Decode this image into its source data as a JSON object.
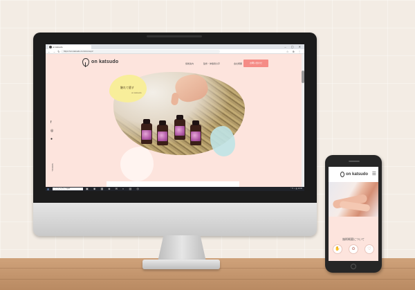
{
  "browser": {
    "tab_title": "on katsudo",
    "window_controls": "– ▢ ✕",
    "nav_icons": "← → ↻ ⌂",
    "url": "https://on-katsudo.com/concept/",
    "extension_icons": "☆ ⊕ ⋮"
  },
  "site": {
    "logo": "on katsudo",
    "nav": [
      "施術案内",
      "監修・体験者の声",
      "会社概要"
    ],
    "contact_button": "お問い合わせ",
    "hero_heading": "触れて癒す",
    "hero_sub": "on katsudo",
    "vertical_text": "SCROLL",
    "social_icons": [
      "facebook-icon",
      "instagram-icon",
      "line-icon"
    ]
  },
  "taskbar": {
    "start": "⊞",
    "search_placeholder": "ここに入力して検索",
    "app_icons": "▣ ◉ ▦ ◈ ✉ ◐ ▤ ◎",
    "tray_text": "^ ☐ ♫ あ 12:00"
  },
  "phone": {
    "logo": "on katsudo",
    "menu_icon": "☰",
    "heading": "施術概要について",
    "feature_icons": [
      "✋",
      "✿",
      "♡"
    ]
  },
  "colors": {
    "brand_pink": "#f58c86",
    "page_bg": "#fde4dd",
    "blob_yellow": "#f8ee9a",
    "blob_blue": "#bfe3e6"
  }
}
